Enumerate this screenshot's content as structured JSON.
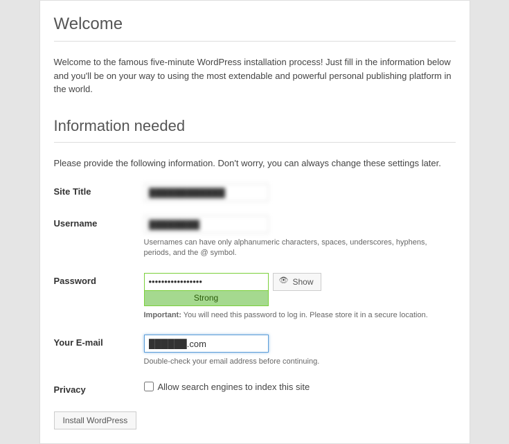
{
  "headings": {
    "welcome": "Welcome",
    "info_needed": "Information needed"
  },
  "intro": "Welcome to the famous five-minute WordPress installation process! Just fill in the information below and you'll be on your way to using the most extendable and powerful personal publishing platform in the world.",
  "info_text": "Please provide the following information. Don't worry, you can always change these settings later.",
  "fields": {
    "site_title": {
      "label": "Site Title",
      "value": "████████████"
    },
    "username": {
      "label": "Username",
      "value": "████████",
      "hint": "Usernames can have only alphanumeric characters, spaces, underscores, hyphens, periods, and the @ symbol."
    },
    "password": {
      "label": "Password",
      "value": "•••••••••••••••••",
      "show_btn": "Show",
      "strength": "Strong",
      "hint_strong": "Important:",
      "hint_rest": " You will need this password to log in. Please store it in a secure location."
    },
    "email": {
      "label": "Your E-mail",
      "value": "██████.com",
      "hint": "Double-check your email address before continuing."
    },
    "privacy": {
      "label": "Privacy",
      "checkbox_label": "Allow search engines to index this site",
      "checked": false
    }
  },
  "submit_label": "Install WordPress"
}
